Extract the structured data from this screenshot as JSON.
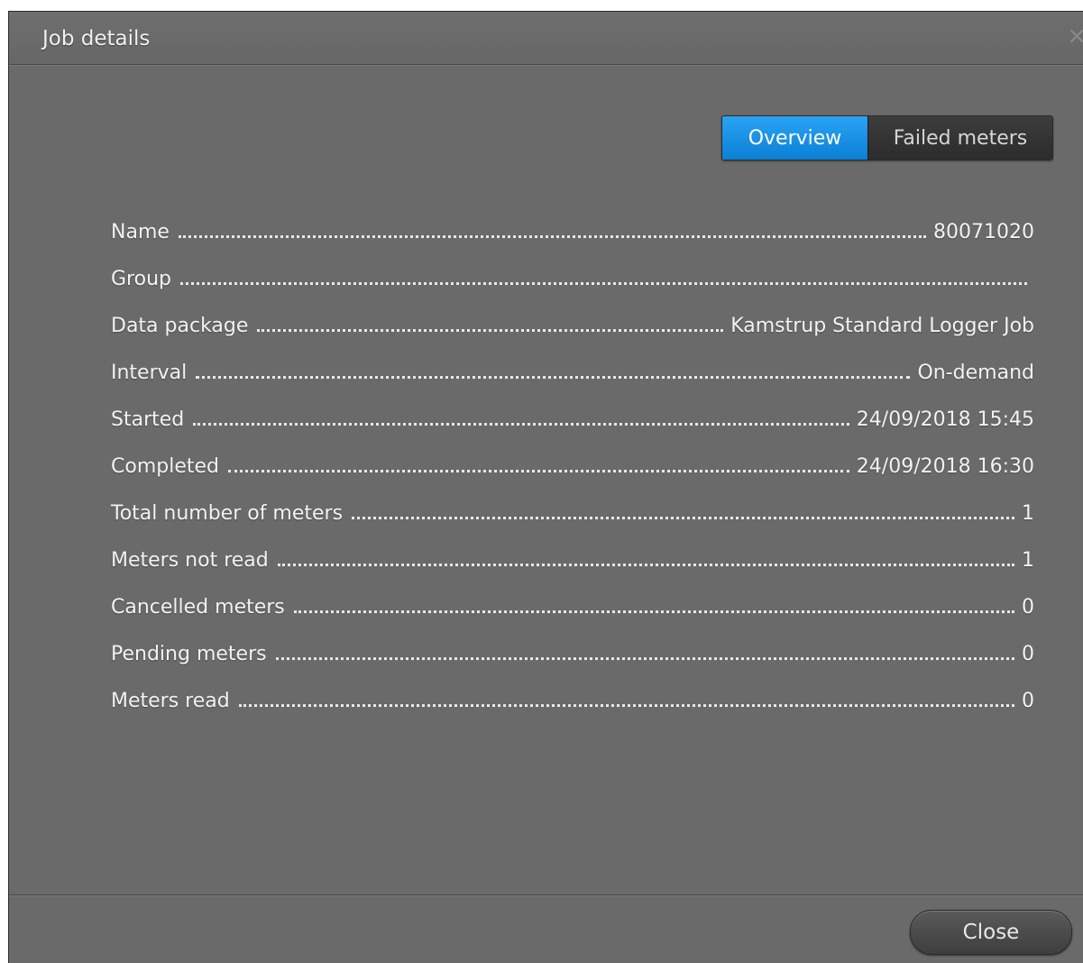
{
  "window": {
    "title": "Job details",
    "close_icon": "×"
  },
  "tabs": [
    {
      "label": "Overview",
      "active": true
    },
    {
      "label": "Failed meters",
      "active": false
    }
  ],
  "details": {
    "rows": [
      {
        "label": "Name",
        "value": "80071020"
      },
      {
        "label": "Group",
        "value": ""
      },
      {
        "label": "Data package",
        "value": "Kamstrup Standard Logger Job"
      },
      {
        "label": "Interval",
        "value": "On-demand"
      },
      {
        "label": "Started",
        "value": "24/09/2018 15:45"
      },
      {
        "label": "Completed",
        "value": "24/09/2018 16:30"
      },
      {
        "label": "Total number of meters",
        "value": "1"
      },
      {
        "label": "Meters not read",
        "value": "1"
      },
      {
        "label": "Cancelled meters",
        "value": "0"
      },
      {
        "label": "Pending meters",
        "value": "0"
      },
      {
        "label": "Meters read",
        "value": "0"
      }
    ]
  },
  "footer": {
    "close_label": "Close"
  },
  "colors": {
    "active_tab": "#1a92e6",
    "background": "#6a6a6a"
  }
}
